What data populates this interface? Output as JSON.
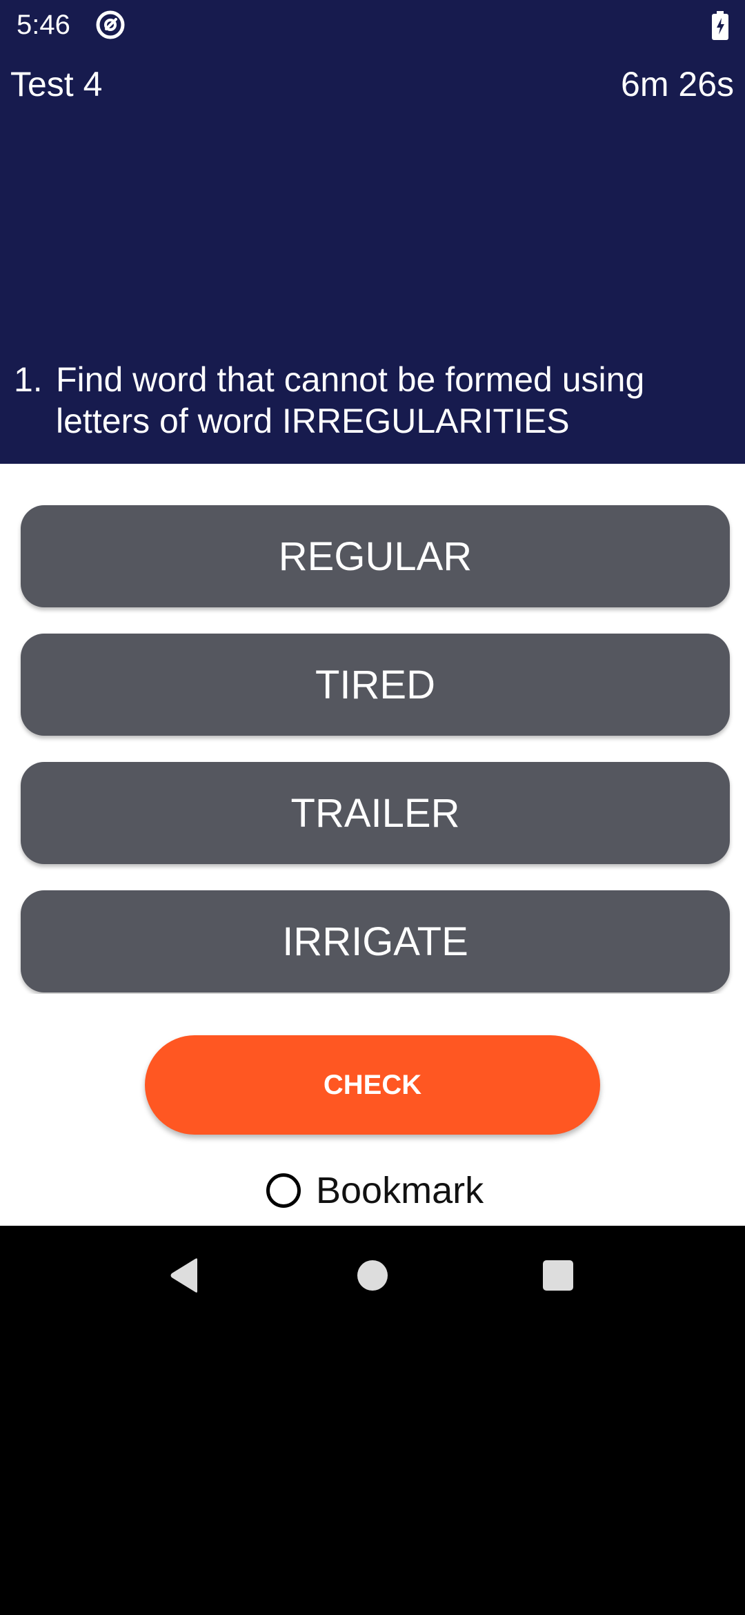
{
  "status_bar": {
    "time": "5:46",
    "app_icon": "at-sign-circle-icon",
    "battery_icon": "battery-charging-icon"
  },
  "header": {
    "test_title": "Test 4",
    "timer": "6m 26s",
    "background_color": "#171B4E"
  },
  "question": {
    "number": "1.",
    "text": "Find word that cannot be formed using letters of word IRREGULARITIES"
  },
  "options": [
    {
      "label": "REGULAR"
    },
    {
      "label": "TIRED"
    },
    {
      "label": "TRAILER"
    },
    {
      "label": "IRRIGATE"
    }
  ],
  "option_color": "#55575F",
  "check_button": {
    "label": "CHECK",
    "color": "#FF5722"
  },
  "bookmark": {
    "label": "Bookmark",
    "checked": false
  },
  "nav_bar": {
    "back_icon": "back-triangle-icon",
    "home_icon": "home-circle-icon",
    "recents_icon": "recents-square-icon"
  }
}
